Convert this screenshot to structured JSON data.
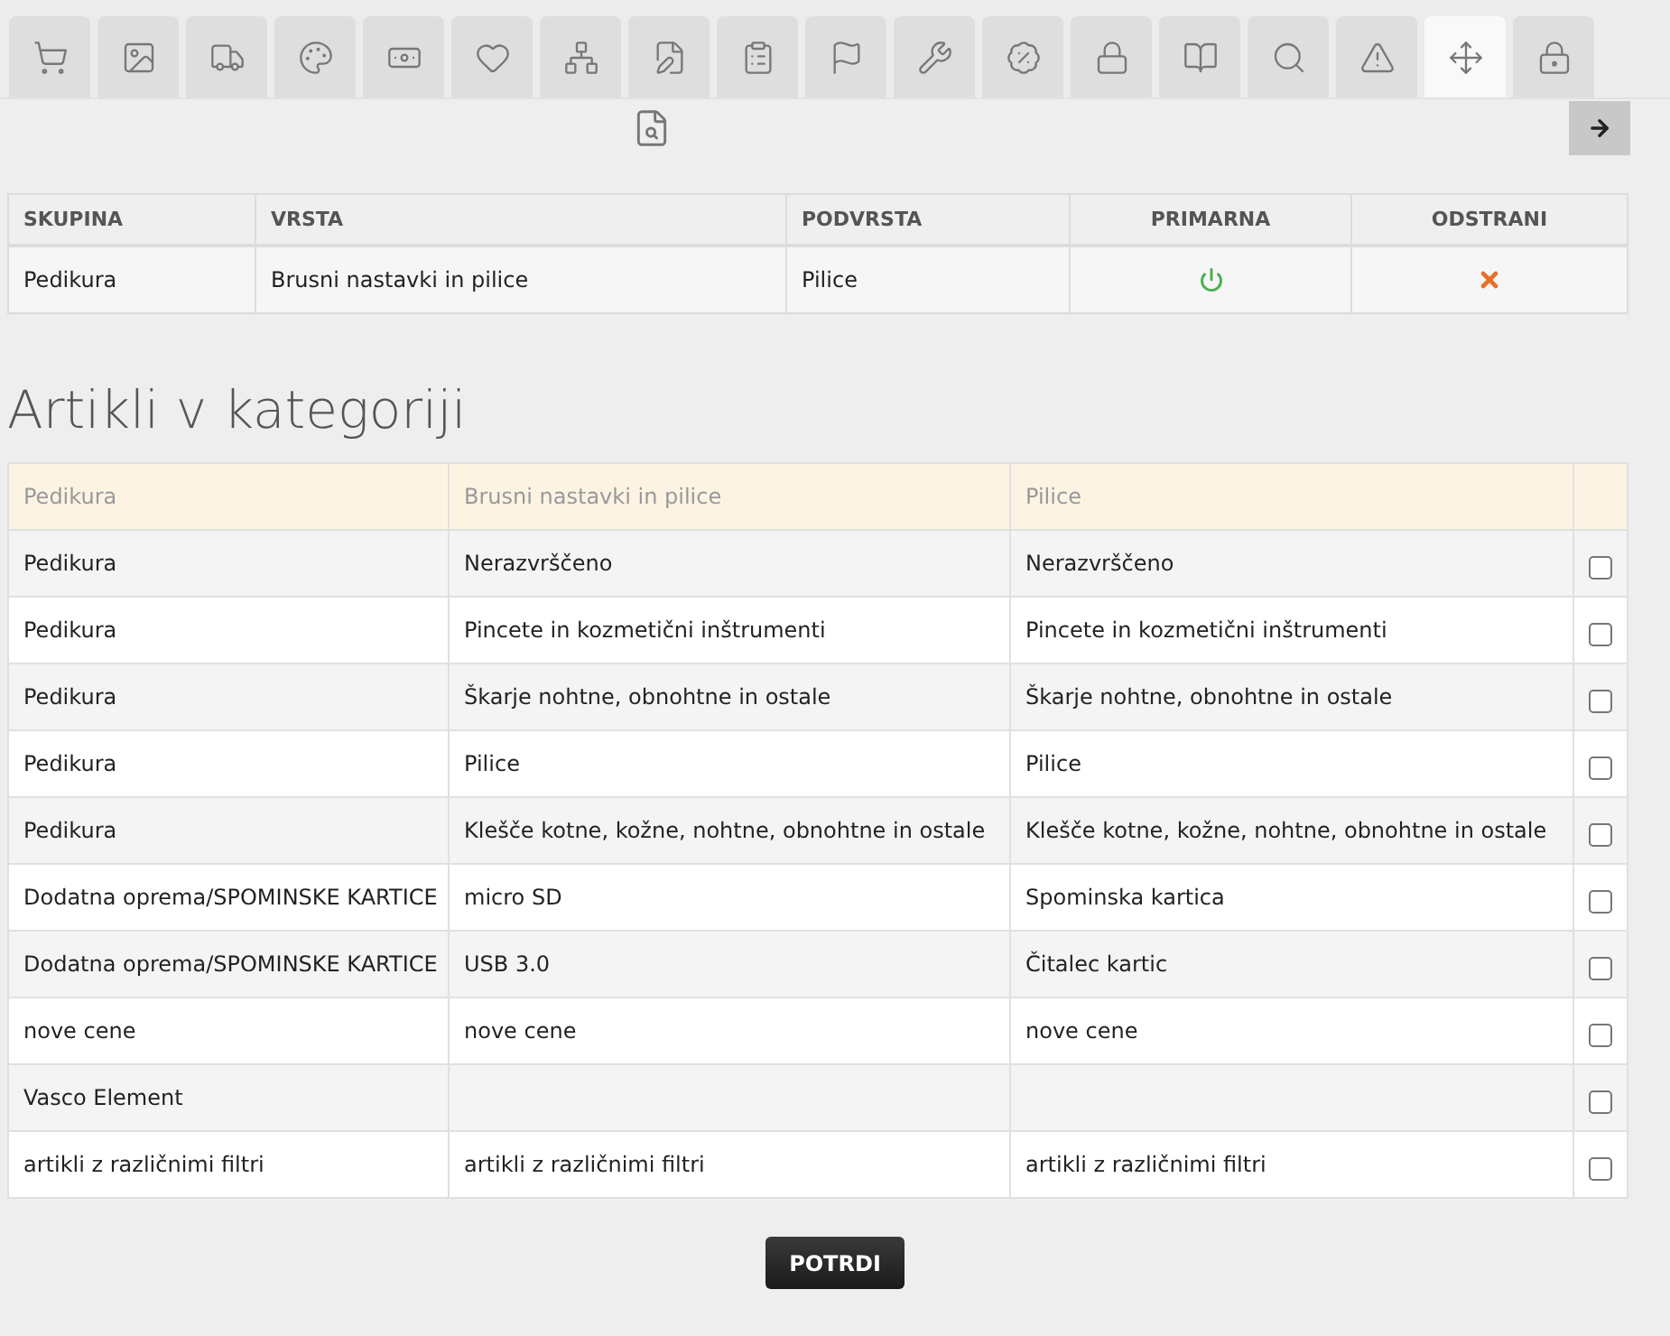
{
  "tabs": [
    {
      "selected": false
    },
    {
      "selected": false
    },
    {
      "selected": false
    },
    {
      "selected": false
    },
    {
      "selected": false
    },
    {
      "selected": false
    },
    {
      "selected": false
    },
    {
      "selected": false
    },
    {
      "selected": false
    },
    {
      "selected": false
    },
    {
      "selected": false
    },
    {
      "selected": false
    },
    {
      "selected": false
    },
    {
      "selected": false
    },
    {
      "selected": false
    },
    {
      "selected": false
    },
    {
      "selected": true
    },
    {
      "selected": false
    }
  ],
  "category_table": {
    "columns": [
      "SKUPINA",
      "VRSTA",
      "PODVRSTA",
      "PRIMARNA",
      "ODSTRANI"
    ],
    "rows": [
      {
        "group": "Pedikura",
        "type": "Brusni nastavki in pilice",
        "subtype": "Pilice",
        "primary": true
      }
    ]
  },
  "articles": {
    "title": "Artikli v kategoriji",
    "header": [
      "Pedikura",
      "Brusni nastavki in pilice",
      "Pilice"
    ],
    "rows": [
      {
        "cells": [
          "Pedikura",
          "Nerazvrščeno",
          "Nerazvrščeno"
        ],
        "checked": false
      },
      {
        "cells": [
          "Pedikura",
          "Pincete in kozmetični inštrumenti",
          "Pincete in kozmetični inštrumenti"
        ],
        "checked": false
      },
      {
        "cells": [
          "Pedikura",
          "Škarje nohtne, obnohtne in ostale",
          "Škarje nohtne, obnohtne in ostale"
        ],
        "checked": false
      },
      {
        "cells": [
          "Pedikura",
          "Pilice",
          "Pilice"
        ],
        "checked": false
      },
      {
        "cells": [
          "Pedikura",
          "Klešče kotne, kožne, nohtne, obnohtne in ostale",
          "Klešče kotne, kožne, nohtne, obnohtne in ostale"
        ],
        "checked": false
      },
      {
        "cells": [
          "Dodatna oprema/SPOMINSKE KARTICE",
          "micro SD",
          "Spominska kartica"
        ],
        "checked": false
      },
      {
        "cells": [
          "Dodatna oprema/SPOMINSKE KARTICE",
          "USB 3.0",
          "Čitalec kartic"
        ],
        "checked": false
      },
      {
        "cells": [
          "nove cene",
          "nove cene",
          "nove cene"
        ],
        "checked": false
      },
      {
        "cells": [
          "Vasco Element",
          "",
          ""
        ],
        "checked": false
      },
      {
        "cells": [
          "artikli z različnimi filtri",
          "artikli z različnimi filtri",
          "artikli z različnimi filtri"
        ],
        "checked": false
      }
    ]
  },
  "confirm_button": "POTRDI"
}
